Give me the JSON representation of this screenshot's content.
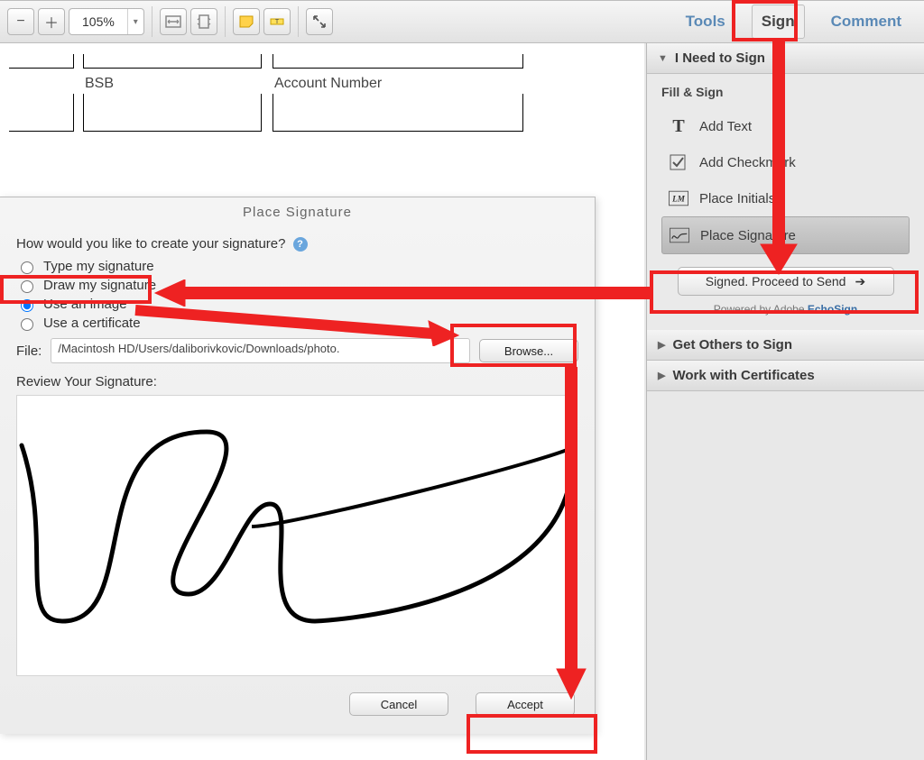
{
  "toolbar": {
    "zoom": "105%",
    "panes": {
      "tools": "Tools",
      "sign": "Sign",
      "comment": "Comment"
    }
  },
  "form": {
    "bsb_label": "BSB",
    "account_label": "Account Number"
  },
  "dialog": {
    "title": "Place Signature",
    "prompt": "How would you like to create your signature?",
    "opt_type": "Type my signature",
    "opt_draw": "Draw my signature",
    "opt_image": "Use an image",
    "opt_cert": "Use a certificate",
    "file_label": "File:",
    "file_path": "/Macintosh HD/Users/daliborivkovic/Downloads/photo.",
    "browse": "Browse...",
    "review": "Review Your Signature:",
    "cancel": "Cancel",
    "accept": "Accept"
  },
  "panel": {
    "need_sign": "I Need to Sign",
    "fill_sign": "Fill & Sign",
    "add_text": "Add Text",
    "add_check": "Add Checkmark",
    "initials": "Place Initials",
    "signature": "Place Signature",
    "proceed": "Signed. Proceed to Send",
    "powered_pre": "Powered by Adobe ",
    "powered_link": "EchoSign",
    "others": "Get Others to Sign",
    "certs": "Work with Certificates"
  }
}
